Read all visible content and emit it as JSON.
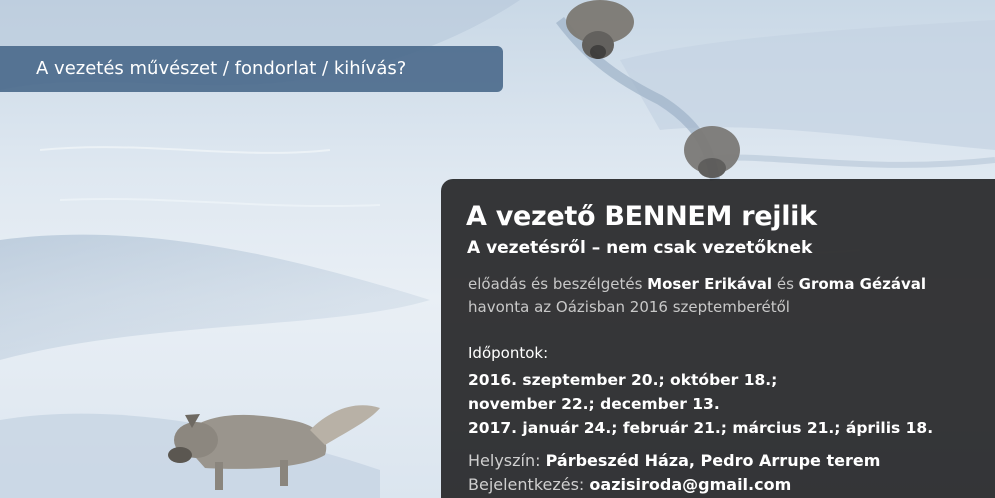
{
  "tagline": "A vezetés művészet / fondorlat / kihívás?",
  "title": "A vezető BENNEM rejlik",
  "subtitle": "A vezetésről – nem csak vezetőknek",
  "intro": {
    "lead": "előadás és beszélgetés",
    "speaker1": "Moser Erikával",
    "and": "és",
    "speaker2": "Groma Gézával",
    "line2": "havonta az Oázisban 2016 szeptemberétől"
  },
  "dates_label": "Időpontok:",
  "dates": [
    "2016. szeptember 20.; október 18.;",
    "november 22.; december 13.",
    "2017. január 24.; február 21.; március 21.; április 18."
  ],
  "location": {
    "label": "Helyszín:",
    "value": "Párbeszéd Háza, Pedro Arrupe terem"
  },
  "registration": {
    "label": "Bejelentkezés:",
    "value": "oazisiroda@gmail.com"
  }
}
